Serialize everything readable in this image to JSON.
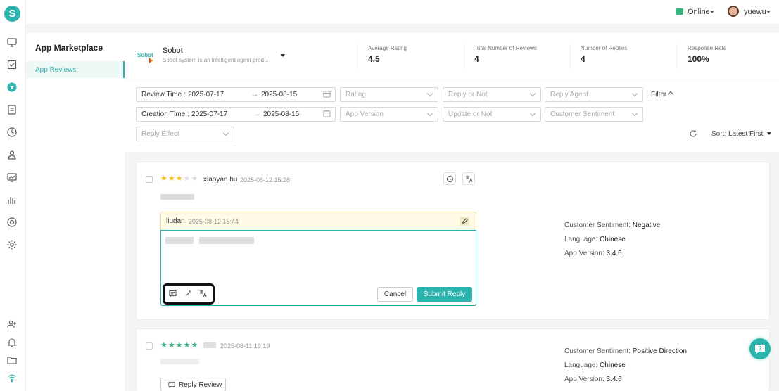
{
  "rail": {
    "logo_letter": "S"
  },
  "topbar": {
    "status": "Online",
    "username": "yuewu"
  },
  "subnav": {
    "title": "App Marketplace",
    "item": "App Reviews"
  },
  "app": {
    "name": "Sobot",
    "description": "Sobot system is an intelligent agent prod...",
    "logo_text": "Sobot"
  },
  "stats": [
    {
      "label": "Average Rating",
      "value": "4.5"
    },
    {
      "label": "Total Number of Reviews",
      "value": "4"
    },
    {
      "label": "Number of Replies",
      "value": "4"
    },
    {
      "label": "Response Rate",
      "value": "100%"
    }
  ],
  "filters": {
    "review_time_label": "Review Time :",
    "review_time_start": "2025-07-17",
    "review_time_end": "2025-08-15",
    "creation_time_label": "Creation Time :",
    "creation_time_start": "2025-07-17",
    "creation_time_end": "2025-08-15",
    "arrow": "→",
    "rating": "Rating",
    "reply_or_not": "Reply or Not",
    "reply_agent": "Reply Agent",
    "filter_toggle": "Filter",
    "app_version": "App Version",
    "update_or_not": "Update or Not",
    "customer_sentiment": "Customer Sentiment",
    "reply_effect": "Reply Effect",
    "sort_prefix": "Sort:",
    "sort_value": "Latest First"
  },
  "reviews": [
    {
      "rating": 3,
      "reviewer": "xiaoyan hu",
      "time": "2025-08-12 15:26",
      "reply_agent": "liudan",
      "reply_time": "2025-08-12 15:44",
      "cancel_label": "Cancel",
      "submit_label": "Submit Reply",
      "sentiment_label": "Customer Sentiment:",
      "sentiment": "Negative",
      "language_label": "Language:",
      "language": "Chinese",
      "version_label": "App Version:",
      "version": "3.4.6"
    },
    {
      "rating": 5,
      "time": "2025-08-11 19:19",
      "reply_label": "Reply Review",
      "sentiment_label": "Customer Sentiment:",
      "sentiment": "Positive Direction",
      "language_label": "Language:",
      "language": "Chinese",
      "version_label": "App Version:",
      "version": "3.4.6"
    }
  ],
  "colors": {
    "accent": "#2bb3ad",
    "online": "#36b37e",
    "star": "#f5c518",
    "star_positive": "#36b37e"
  },
  "icons": [
    "monitor-icon",
    "check-icon",
    "app-icon",
    "document-icon",
    "clock-icon",
    "users-icon",
    "chart-icon",
    "bars-icon",
    "lifebuoy-icon",
    "gear-icon",
    "user-add-icon",
    "bell-icon",
    "folder-icon",
    "wifi-icon"
  ]
}
